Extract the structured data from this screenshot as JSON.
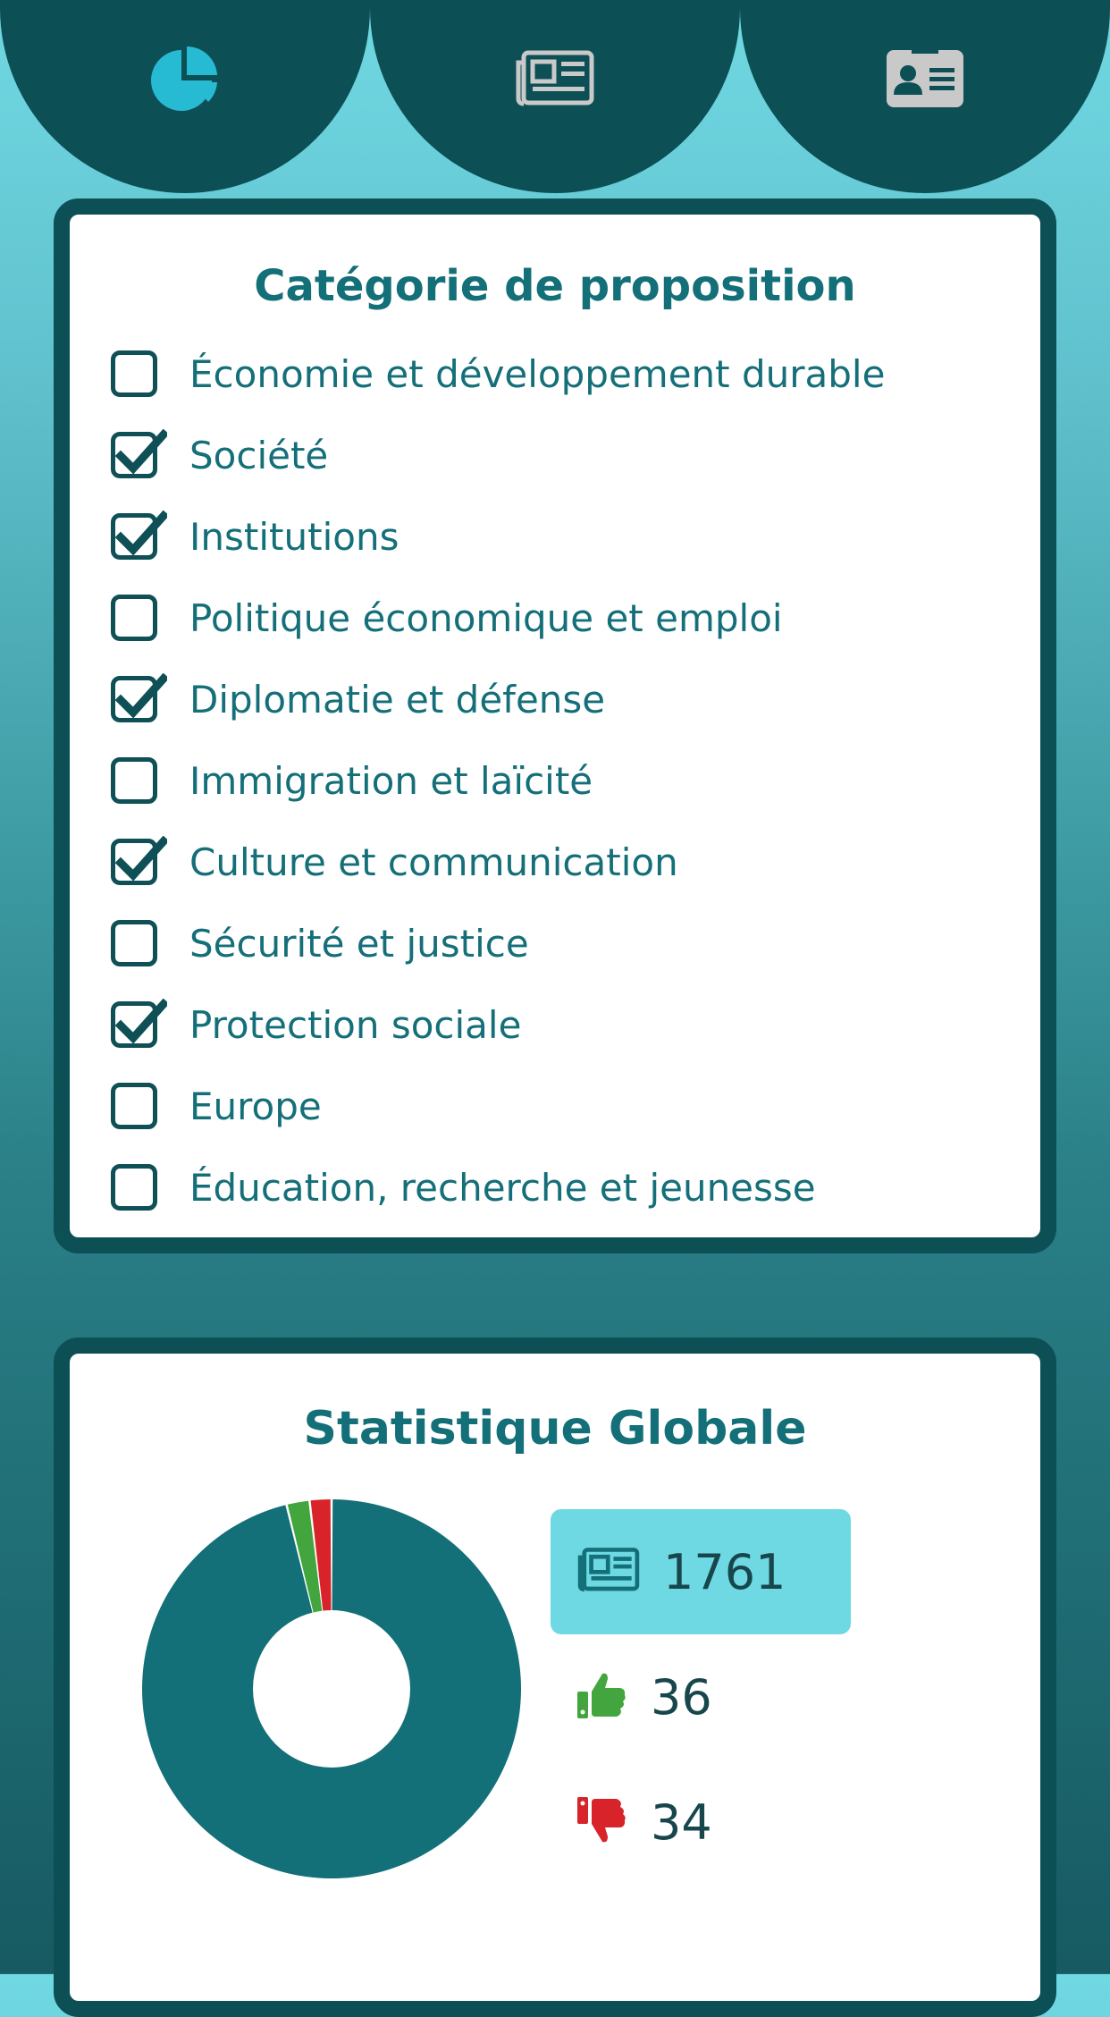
{
  "nav": {
    "tabs": [
      {
        "icon": "pie-chart-icon",
        "active": true,
        "color": "#27bad3"
      },
      {
        "icon": "newspaper-icon",
        "active": false,
        "color": "#c9c9c9"
      },
      {
        "icon": "id-card-icon",
        "active": false,
        "color": "#c9c9c9"
      }
    ]
  },
  "categories": {
    "title": "Catégorie de proposition",
    "items": [
      {
        "label": "Économie et développement durable",
        "checked": false
      },
      {
        "label": "Société",
        "checked": true
      },
      {
        "label": "Institutions",
        "checked": true
      },
      {
        "label": "Politique économique et emploi",
        "checked": false
      },
      {
        "label": "Diplomatie et défense",
        "checked": true
      },
      {
        "label": "Immigration et laïcité",
        "checked": false
      },
      {
        "label": "Culture et communication",
        "checked": true
      },
      {
        "label": "Sécurité et justice",
        "checked": false
      },
      {
        "label": "Protection sociale",
        "checked": true
      },
      {
        "label": "Europe",
        "checked": false
      },
      {
        "label": "Éducation, recherche et jeunesse",
        "checked": false
      }
    ]
  },
  "stats": {
    "title": "Statistique Globale",
    "propositions": "1761",
    "likes": "36",
    "dislikes": "34",
    "colors": {
      "propositions": "#136f78",
      "likes": "#43a53d",
      "dislikes": "#d8232a",
      "highlight": "#6ed8e3"
    }
  },
  "chart_data": {
    "type": "pie",
    "title": "",
    "labels": [
      "",
      "",
      ""
    ],
    "values": [
      1761,
      36,
      34
    ],
    "colors": [
      "#136f78",
      "#43a53d",
      "#d8232a"
    ]
  }
}
